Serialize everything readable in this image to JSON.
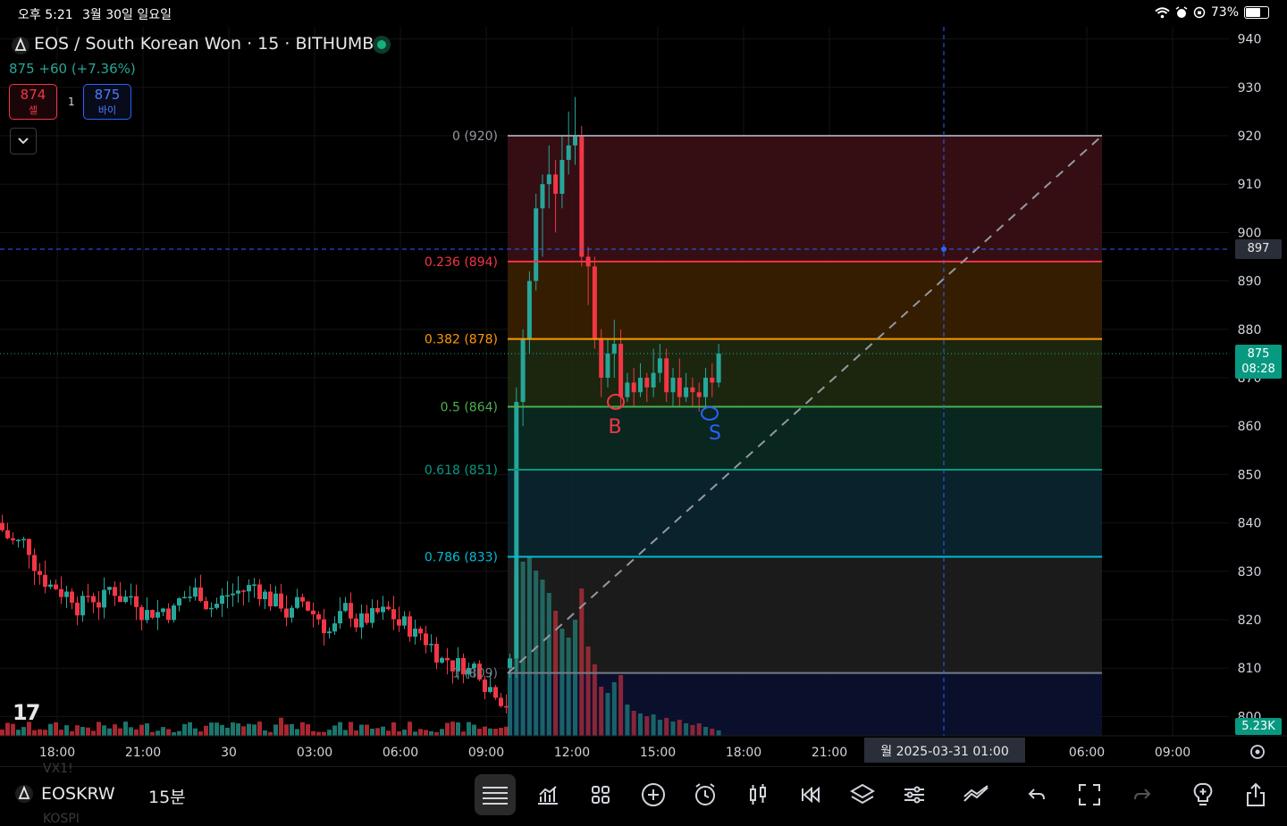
{
  "status_bar": {
    "time": "오후 5:21",
    "date": "3월 30일 일요일",
    "battery": "73%",
    "battery_level": 0.73,
    "icons": [
      "wifi-icon",
      "alarm-icon",
      "orientation-lock-icon"
    ]
  },
  "header": {
    "title": "EOS / South Korean Won · 15 · BITHUMB",
    "price_line": "875 +60 (+7.36%)",
    "sell": {
      "price": "874",
      "label": "셀"
    },
    "buy": {
      "price": "875",
      "label": "바이"
    },
    "spread": "1"
  },
  "watermark": "17",
  "price_axis": {
    "ticks": [
      "940",
      "930",
      "920",
      "910",
      "900",
      "890",
      "880",
      "870",
      "860",
      "850",
      "840",
      "830",
      "820",
      "810",
      "800"
    ],
    "crosshair_label": "897",
    "last_price_label": "875",
    "countdown_label": "08:28",
    "volume_label": "5.23K"
  },
  "time_axis": {
    "ticks": [
      "18:00",
      "21:00",
      "30",
      "03:00",
      "06:00",
      "09:00",
      "12:00",
      "15:00",
      "18:00",
      "21:00",
      "06:00",
      "09:00"
    ],
    "crosshair_label": "월 2025-03-31   01:00"
  },
  "fib_levels": [
    {
      "label": "0 (920)",
      "value": 920,
      "color": "#9598a1"
    },
    {
      "label": "0.236 (894)",
      "value": 894,
      "color": "#f23645"
    },
    {
      "label": "0.382 (878)",
      "value": 878,
      "color": "#ff9800"
    },
    {
      "label": "0.5 (864)",
      "value": 864,
      "color": "#4caf50"
    },
    {
      "label": "0.618 (851)",
      "value": 851,
      "color": "#089981"
    },
    {
      "label": "0.786 (833)",
      "value": 833,
      "color": "#00bcd4"
    },
    {
      "label": "1 (809)",
      "value": 809,
      "color": "#787b86"
    }
  ],
  "annotations": {
    "buy_mark": "B",
    "sell_mark": "S"
  },
  "toolbar": {
    "symbol": "EOSKRW",
    "interval": "15분",
    "ghost_text_1": "VX1!",
    "ghost_text_2": "KOSPI"
  },
  "colors": {
    "up": "#26a69a",
    "down": "#f23645",
    "crosshair": "#2962ff",
    "fib_box_top": "#f23645",
    "fib_box_bottom": "#2962ff"
  }
}
